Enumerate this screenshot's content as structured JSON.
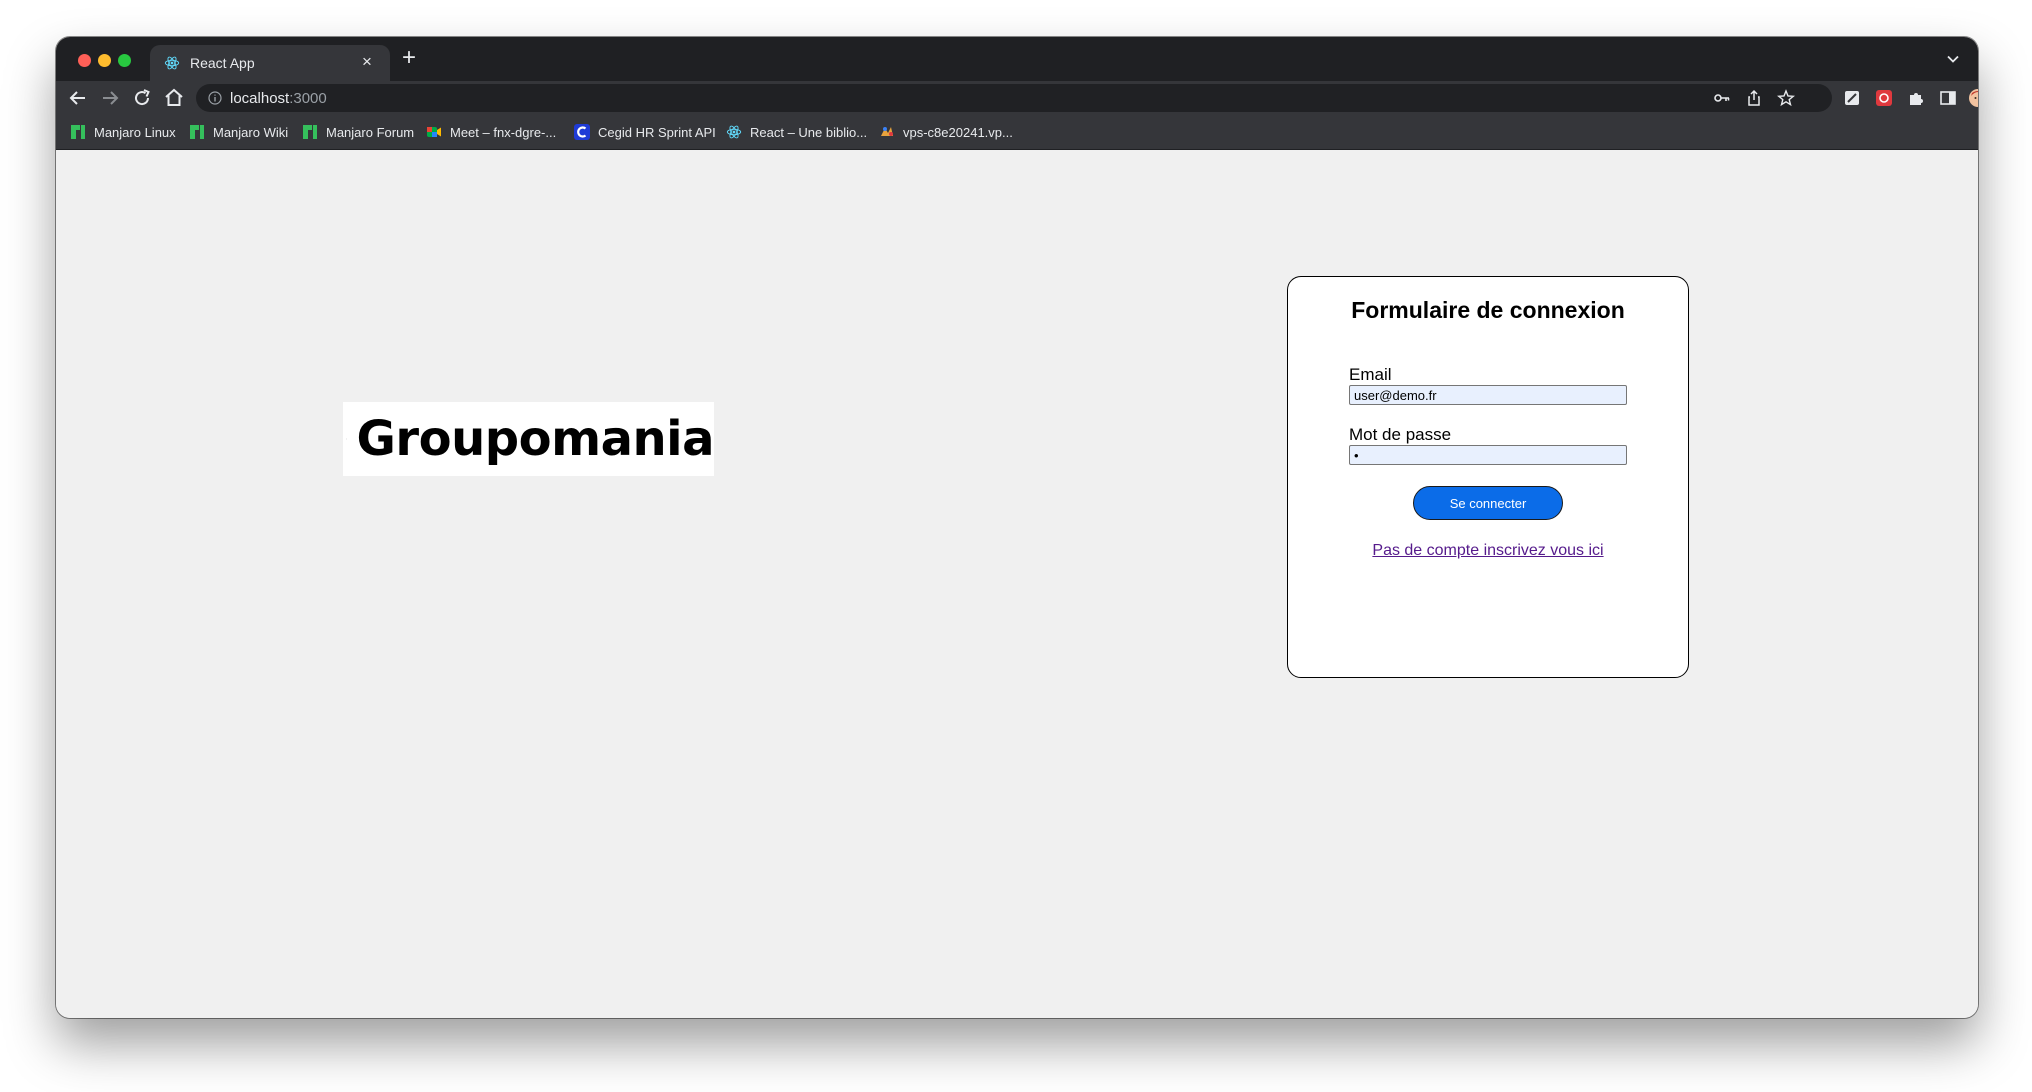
{
  "browser": {
    "tab": {
      "title": "React App"
    },
    "url": {
      "host": "localhost",
      "port": ":3000"
    },
    "bookmarks": [
      {
        "label": "Manjaro Linux",
        "icon": "manjaro-icon"
      },
      {
        "label": "Manjaro Wiki",
        "icon": "manjaro-icon"
      },
      {
        "label": "Manjaro Forum",
        "icon": "manjaro-icon"
      },
      {
        "label": "Meet – fnx-dgre-...",
        "icon": "meet-icon"
      },
      {
        "label": "Cegid HR Sprint API",
        "icon": "cegid-icon"
      },
      {
        "label": "React – Une biblio...",
        "icon": "react-icon"
      },
      {
        "label": "vps-c8e20241.vp...",
        "icon": "vps-icon"
      }
    ]
  },
  "logo": {
    "text": "Groupomania",
    "icon": "globe-icon"
  },
  "login": {
    "title": "Formulaire de connexion",
    "email_label": "Email",
    "email_value": "user@demo.fr",
    "password_label": "Mot de passe",
    "password_value": "•",
    "submit_label": "Se connecter",
    "signup_link": "Pas de compte inscrivez vous ici"
  },
  "colors": {
    "accent_button": "#0b6ce8",
    "visited_link": "#551a8b",
    "page_background": "#f0f0f0",
    "autofill_background": "#e8f0fe"
  }
}
